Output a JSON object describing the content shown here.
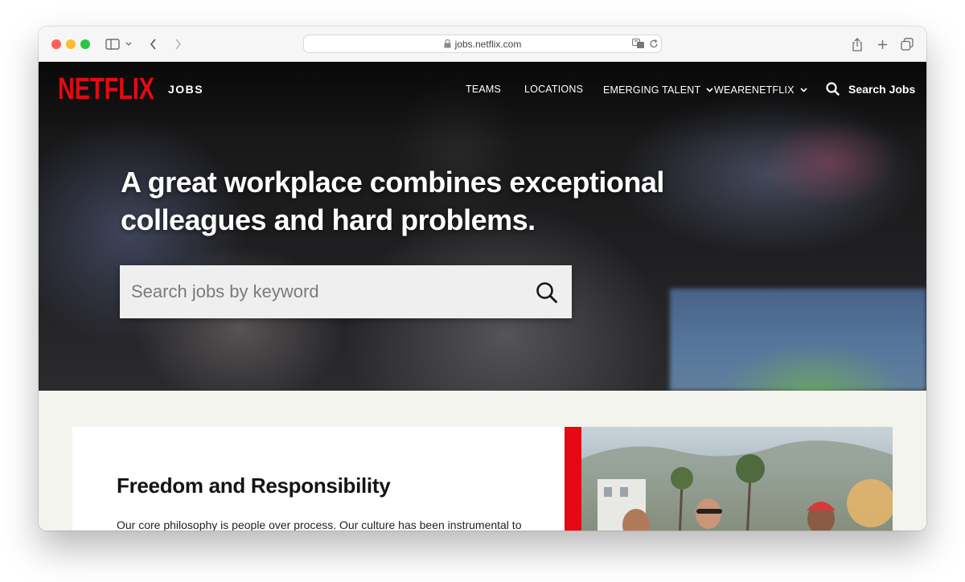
{
  "browser": {
    "url": "jobs.netflix.com"
  },
  "site": {
    "logo_text": "NETFLIX",
    "section_label": "JOBS",
    "brand_color": "#E50914"
  },
  "nav": {
    "items": [
      {
        "label": "TEAMS",
        "has_dropdown": false
      },
      {
        "label": "LOCATIONS",
        "has_dropdown": false
      },
      {
        "label": "EMERGING TALENT",
        "has_dropdown": true
      },
      {
        "label": "WEARENETFLIX",
        "has_dropdown": true
      }
    ],
    "search_label": "Search Jobs"
  },
  "hero": {
    "headline": "A great workplace combines exceptional colleagues and hard problems.",
    "search_placeholder": "Search jobs by keyword"
  },
  "feature": {
    "title": "Freedom and Responsibility",
    "text": "Our core philosophy is people over process. Our culture has been instrumental to"
  }
}
